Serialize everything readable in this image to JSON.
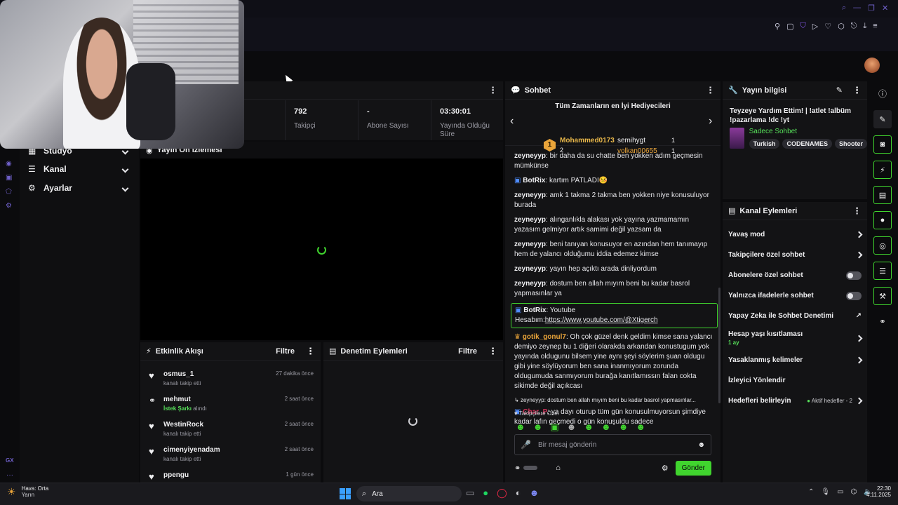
{
  "stats": [
    {
      "value": "792",
      "label": "Takipçi"
    },
    {
      "value": "-",
      "label": "Abone Sayısı"
    },
    {
      "value": "03:30:01",
      "label": "Yayında Olduğu Süre"
    }
  ],
  "nav": {
    "items": [
      {
        "label": "Stüdyo"
      },
      {
        "label": "Kanal"
      },
      {
        "label": "Ayarlar"
      }
    ]
  },
  "preview": {
    "title": "Yayın Ön İzlemesi"
  },
  "activity": {
    "title": "Etkinlik Akışı",
    "filter": "Filtre",
    "items": [
      {
        "name": "osmus_1",
        "detail": "kanalı takip etti",
        "highlight": "",
        "time": "27 dakika önce"
      },
      {
        "name": "mehmut",
        "detail": "alındı",
        "highlight": "İstek Şarkı",
        "time": "2 saat önce"
      },
      {
        "name": "WestinRock",
        "detail": "kanalı takip etti",
        "highlight": "",
        "time": "2 saat önce"
      },
      {
        "name": "cimenyiyenadam",
        "detail": "kanalı takip etti",
        "highlight": "",
        "time": "2 saat önce"
      },
      {
        "name": "ppengu",
        "detail": "",
        "highlight": "",
        "time": "1 gün önce"
      }
    ]
  },
  "moderation": {
    "title": "Denetim Eylemleri",
    "filter": "Filtre"
  },
  "chat": {
    "title": "Sohbet",
    "top_gifters_title": "Tüm Zamanların en İyi Hediyecileri",
    "gifter1": {
      "rank": "1",
      "name": "Mohammed0173",
      "count": "2"
    },
    "gifter2": {
      "name": "semihygt",
      "count": "1"
    },
    "gifter3": {
      "name": "volkan00655",
      "count": "1"
    },
    "messages": [
      {
        "user": "zeyneyyp",
        "text": "bir daha da su chatte ben yokken adım geçmesin mümkünse"
      },
      {
        "user": "BotRix",
        "text": "kartım PATLADI🤒"
      },
      {
        "user": "zeyneyyp",
        "text": "amk 1 takma 2 takma ben yokken niye konusuluyor burada"
      },
      {
        "user": "zeyneyyp",
        "text": "alınganlıkla alakası yok yayına yazmamamın yazasım gelmiyor artık samimi değil yazsam da"
      },
      {
        "user": "zeyneyyp",
        "text": "beni tanıyan konusuyor en azından hem tanımayıp hem de yalancı olduğumu iddia edemez kimse"
      },
      {
        "user": "zeyneyyp",
        "text": "yayın hep açıktı arada dinliyordum"
      },
      {
        "user": "zeyneyyp",
        "text": "dostum ben allah mıyım beni bu kadar basrol yapmasınlar ya"
      }
    ],
    "pinned": {
      "user": "BotRix",
      "text": "Youtube",
      "prefix": "Hesabım:",
      "link": "https://www.youtube.com/@Xtigerch"
    },
    "long_msg": {
      "user": "gotik_gonul7",
      "text": "Oh çok güzel denk geldim kimse sana yalancı demiyo zeynep bu 1 diğeri olarakda arkandan konustugum yok yayında oldugunu bilsem yine aynı şeyi söylerim şuan oldugu gibi yine söylüyorum ben sana inanmıyorum zorunda oldugumuda sanmıyorum burağa kanıtlamıssın falan cokta sikimde değil açıkcası"
    },
    "reply_ref": "zeyneyyp: dostum ben allah mıyım beni bu kadar basrol yapmasınlar...",
    "reply_msg": {
      "user": "Char_P",
      "text": "ya dayı oturup tüm gün konusulmuyorsun şimdiye kadar lafın geçmedi o gün konuşuldu sadece"
    },
    "followers_only": "Takipçilere Özel",
    "input_placeholder": "Bir mesaj gönderin",
    "send": "Gönder"
  },
  "stream_info": {
    "title": "Yayın bilgisi",
    "stream_title": "Teyzeye Yardım Ettim! | !atlet !albüm !pazarlama !dc !yt",
    "category": "Sadece Sohbet",
    "tags": [
      "Turkish",
      "CODENAMES",
      "Shooter"
    ]
  },
  "channel_actions": {
    "title": "Kanal Eylemleri",
    "items": [
      {
        "label": "Yavaş mod",
        "sub": "",
        "kind": "chevron"
      },
      {
        "label": "Takipçilere özel sohbet",
        "sub": "",
        "kind": "chevron"
      },
      {
        "label": "Abonelere özel sohbet",
        "sub": "",
        "kind": "toggle"
      },
      {
        "label": "Yalnızca ifadelerle sohbet",
        "sub": "",
        "kind": "toggle"
      },
      {
        "label": "Yapay Zeka ile Sohbet Denetimi",
        "sub": "",
        "kind": "external"
      },
      {
        "label": "Hesap yaşı kısıtlaması",
        "sub": "1 ay",
        "kind": "chevron"
      },
      {
        "label": "Yasaklanmış kelimeler",
        "sub": "",
        "kind": "chevron"
      },
      {
        "label": "İzleyici Yönlendir",
        "sub": "",
        "kind": "none"
      },
      {
        "label": "Hedefleri belirleyin",
        "sub": "",
        "kind": "goals"
      }
    ],
    "goals_status": "Aktif hedefler - 2"
  },
  "sidebar_text": "GX",
  "taskbar": {
    "weather": "Hava: Orta",
    "weather_sub": "Yarın",
    "search": "Ara",
    "time": "22:30",
    "date": "4.11.2025"
  },
  "colors": {
    "accent": "#40d42e",
    "bg": "#0b0b0d",
    "panel": "#131315"
  }
}
